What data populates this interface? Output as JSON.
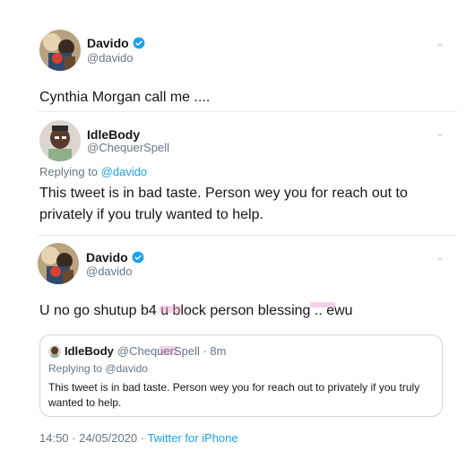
{
  "tweet1": {
    "name": "Davido",
    "handle": "@davido",
    "text": "Cynthia Morgan call me ...."
  },
  "tweet2": {
    "name": "IdleBody",
    "handle": "@ChequerSpell",
    "replying_prefix": "Replying to ",
    "replying_to": "@davido",
    "text": "This tweet is in bad taste. Person wey you for reach out to privately if you truly wanted to help."
  },
  "tweet3": {
    "name": "Davido",
    "handle": "@davido",
    "text": "U no go shutup b4 u block person blessing .. ewu"
  },
  "quote": {
    "name": "IdleBody",
    "handle_time": "@ChequerSpell · 8m",
    "replying": "Replying to @davido",
    "text": "This tweet is in bad taste. Person wey you for reach out to privately if you truly wanted to help."
  },
  "footer": {
    "datetime": "14:50 · 24/05/2020 · ",
    "source": "Twitter for iPhone"
  },
  "colors": {
    "verified": "#1da1f2",
    "link": "#1da1f2",
    "secondary": "#657786"
  },
  "icons": [
    "verified-badge-icon",
    "chevron-down-icon"
  ]
}
